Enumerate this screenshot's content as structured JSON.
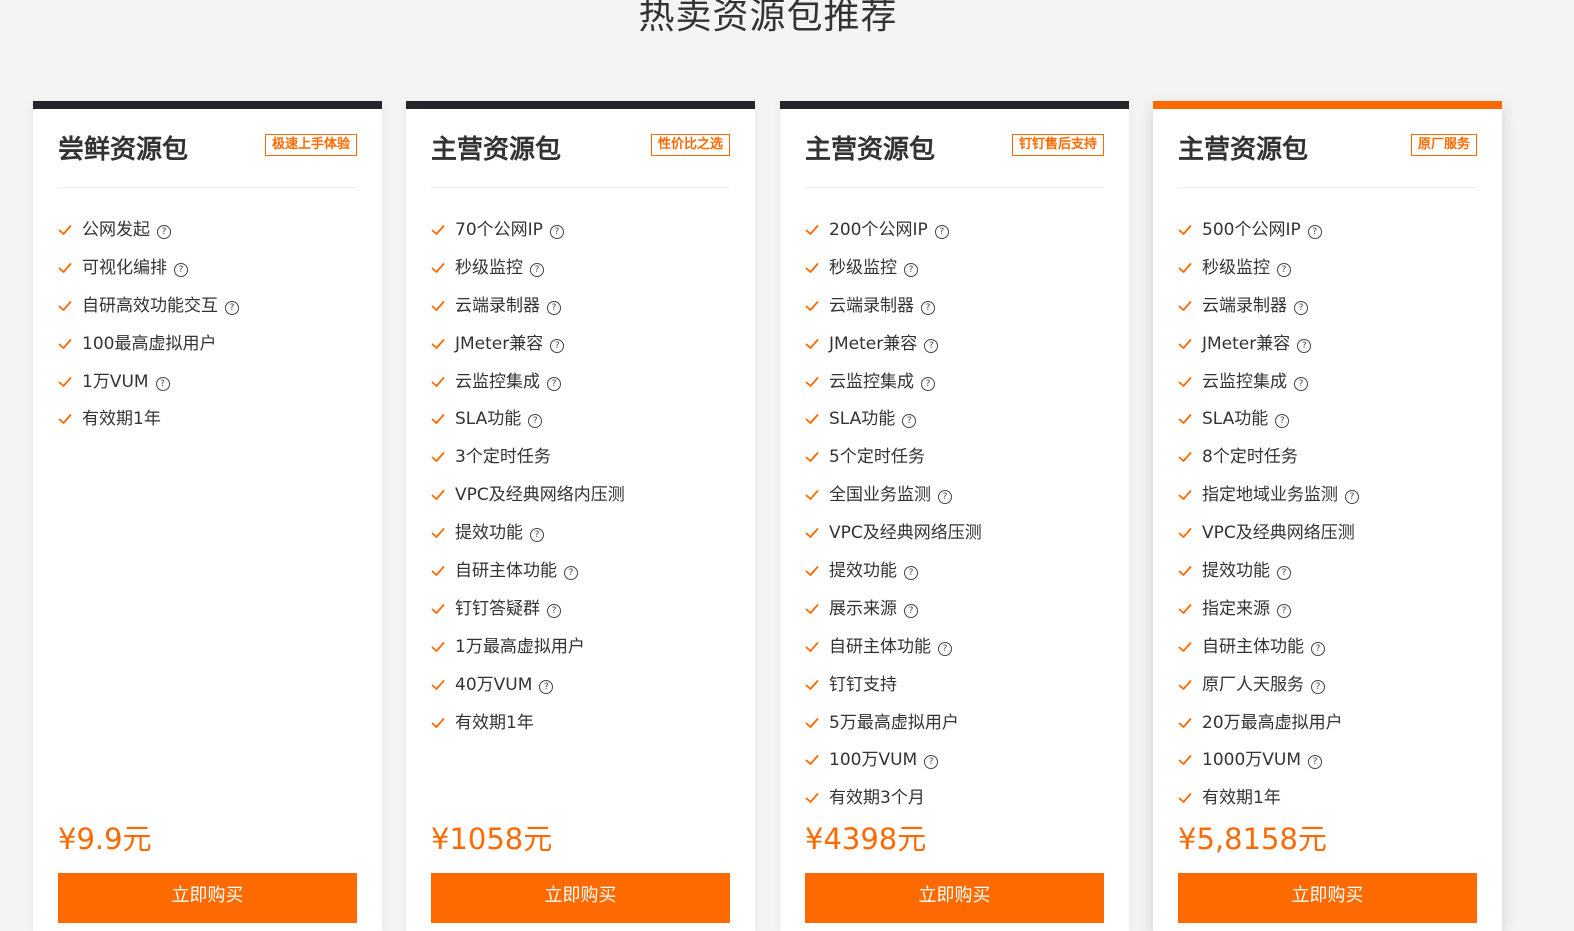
{
  "page": {
    "title": "热卖资源包推荐"
  },
  "ui": {
    "accent": "#ff6a00",
    "header_dark": "#25262a",
    "check_icon": "check-icon",
    "help_icon": "question-circle-icon"
  },
  "cards": [
    {
      "title": "尝鲜资源包",
      "tag": "极速上手体验",
      "features": [
        {
          "label": "公网发起",
          "help": true
        },
        {
          "label": "可视化编排",
          "help": true
        },
        {
          "label": "自研高效功能交互",
          "help": true
        },
        {
          "label": "100最高虚拟用户",
          "help": false
        },
        {
          "label": "1万VUM",
          "help": true
        },
        {
          "label": "有效期1年",
          "help": false
        }
      ],
      "price": "¥9.9元",
      "buy": "立即购买"
    },
    {
      "title": "主营资源包",
      "tag": "性价比之选",
      "features": [
        {
          "label": "70个公网IP",
          "help": true
        },
        {
          "label": "秒级监控",
          "help": true
        },
        {
          "label": "云端录制器",
          "help": true
        },
        {
          "label": "JMeter兼容",
          "help": true
        },
        {
          "label": "云监控集成",
          "help": true
        },
        {
          "label": "SLA功能",
          "help": true
        },
        {
          "label": "3个定时任务",
          "help": false
        },
        {
          "label": "VPC及经典网络内压测",
          "help": false
        },
        {
          "label": "提效功能",
          "help": true
        },
        {
          "label": "自研主体功能",
          "help": true
        },
        {
          "label": "钉钉答疑群",
          "help": true
        },
        {
          "label": "1万最高虚拟用户",
          "help": false
        },
        {
          "label": "40万VUM",
          "help": true
        },
        {
          "label": "有效期1年",
          "help": false
        }
      ],
      "price": "¥1058元",
      "buy": "立即购买"
    },
    {
      "title": "主营资源包",
      "tag": "钉钉售后支持",
      "features": [
        {
          "label": "200个公网IP",
          "help": true
        },
        {
          "label": "秒级监控",
          "help": true
        },
        {
          "label": "云端录制器",
          "help": true
        },
        {
          "label": "JMeter兼容",
          "help": true
        },
        {
          "label": "云监控集成",
          "help": true
        },
        {
          "label": "SLA功能",
          "help": true
        },
        {
          "label": "5个定时任务",
          "help": false
        },
        {
          "label": "全国业务监测",
          "help": true
        },
        {
          "label": "VPC及经典网络压测",
          "help": false
        },
        {
          "label": "提效功能",
          "help": true
        },
        {
          "label": "展示来源",
          "help": true
        },
        {
          "label": "自研主体功能",
          "help": true
        },
        {
          "label": "钉钉支持",
          "help": false
        },
        {
          "label": "5万最高虚拟用户",
          "help": false
        },
        {
          "label": "100万VUM",
          "help": true
        },
        {
          "label": "有效期3个月",
          "help": false
        }
      ],
      "price": "¥4398元",
      "buy": "立即购买"
    },
    {
      "title": "主营资源包",
      "tag": "原厂服务",
      "active": true,
      "features": [
        {
          "label": "500个公网IP",
          "help": true
        },
        {
          "label": "秒级监控",
          "help": true
        },
        {
          "label": "云端录制器",
          "help": true
        },
        {
          "label": "JMeter兼容",
          "help": true
        },
        {
          "label": "云监控集成",
          "help": true
        },
        {
          "label": "SLA功能",
          "help": true
        },
        {
          "label": "8个定时任务",
          "help": false
        },
        {
          "label": "指定地域业务监测",
          "help": true
        },
        {
          "label": "VPC及经典网络压测",
          "help": false
        },
        {
          "label": "提效功能",
          "help": true
        },
        {
          "label": "指定来源",
          "help": true
        },
        {
          "label": "自研主体功能",
          "help": true
        },
        {
          "label": "原厂人天服务",
          "help": true
        },
        {
          "label": "20万最高虚拟用户",
          "help": false
        },
        {
          "label": "1000万VUM",
          "help": true
        },
        {
          "label": "有效期1年",
          "help": false
        }
      ],
      "price": "¥5,8158元",
      "buy": "立即购买"
    }
  ]
}
